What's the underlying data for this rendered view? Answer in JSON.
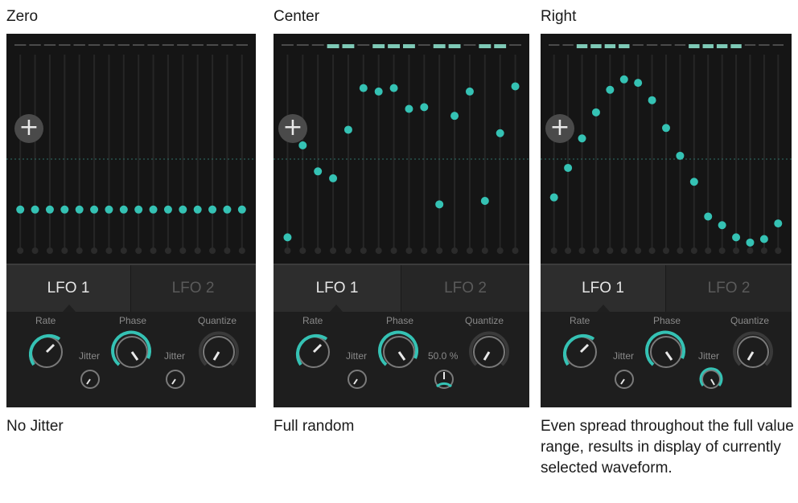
{
  "panels": [
    {
      "title": "Zero",
      "caption": "No Jitter",
      "tabs": [
        "LFO 1",
        "LFO 2"
      ],
      "controls": {
        "rate": "Rate",
        "phase": "Phase",
        "quantize": "Quantize",
        "jitter1": "Jitter",
        "jitter2": "Jitter"
      },
      "step_values": [
        0.2,
        0.2,
        0.2,
        0.2,
        0.2,
        0.2,
        0.2,
        0.2,
        0.2,
        0.2,
        0.2,
        0.2,
        0.2,
        0.2,
        0.2,
        0.2
      ],
      "active_steps": []
    },
    {
      "title": "Center",
      "caption": "Full random",
      "tabs": [
        "LFO 1",
        "LFO 2"
      ],
      "controls": {
        "rate": "Rate",
        "phase": "Phase",
        "quantize": "Quantize",
        "jitter1": "Jitter",
        "jitter2": "50.0 %"
      },
      "step_values": [
        0.04,
        0.57,
        0.42,
        0.38,
        0.66,
        0.9,
        0.88,
        0.9,
        0.78,
        0.79,
        0.23,
        0.74,
        0.88,
        0.25,
        0.64,
        0.91
      ],
      "active_steps": [
        3,
        4,
        6,
        7,
        8,
        10,
        11,
        13,
        14
      ]
    },
    {
      "title": "Right",
      "caption": "Even spread throughout the full value  range, results in display of currently selected waveform.",
      "tabs": [
        "LFO 1",
        "LFO 2"
      ],
      "controls": {
        "rate": "Rate",
        "phase": "Phase",
        "quantize": "Quantize",
        "jitter1": "Jitter",
        "jitter2": "Jitter"
      },
      "step_values": [
        0.27,
        0.44,
        0.61,
        0.76,
        0.89,
        0.95,
        0.93,
        0.83,
        0.67,
        0.51,
        0.36,
        0.16,
        0.11,
        0.04,
        0.01,
        0.03,
        0.12
      ],
      "active_steps": [
        2,
        3,
        4,
        5,
        10,
        11,
        12,
        13
      ]
    }
  ],
  "colors": {
    "accent": "#35c2b4",
    "dot_inactive": "#2b2b2b",
    "active_step": "#7ec9b6",
    "inactive_step": "#4a4a4a"
  }
}
